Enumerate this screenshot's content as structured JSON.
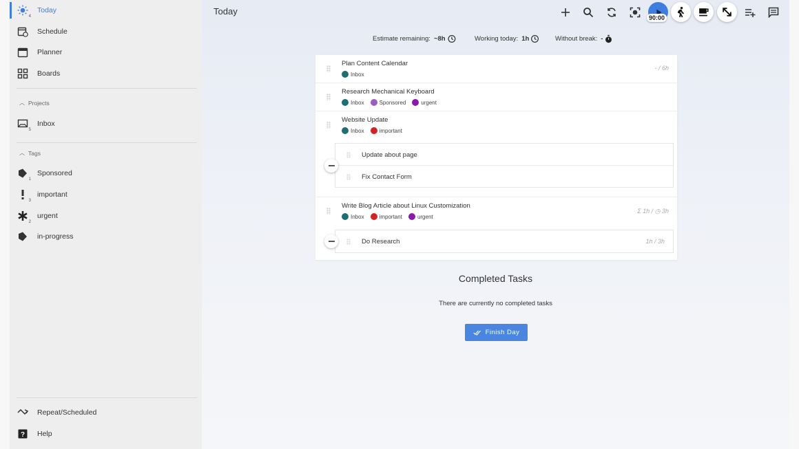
{
  "sidebar": {
    "nav": [
      {
        "label": "Today",
        "badge": "4",
        "active": true
      },
      {
        "label": "Schedule"
      },
      {
        "label": "Planner"
      },
      {
        "label": "Boards"
      }
    ],
    "projects_header": "Projects",
    "projects": [
      {
        "label": "Inbox",
        "badge": "5"
      }
    ],
    "tags_header": "Tags",
    "tags": [
      {
        "label": "Sponsored",
        "badge": "1"
      },
      {
        "label": "important",
        "badge": "3"
      },
      {
        "label": "urgent",
        "badge": "2"
      },
      {
        "label": "in-progress"
      }
    ],
    "bottom": [
      {
        "label": "Repeat/Scheduled"
      },
      {
        "label": "Help"
      }
    ]
  },
  "header": {
    "title": "Today",
    "timer": "90:00"
  },
  "stats": {
    "estimate_label": "Estimate remaining:",
    "estimate_value": "~8h",
    "working_label": "Working today:",
    "working_value": "1h",
    "break_label": "Without break:",
    "break_value": "-"
  },
  "tasks": [
    {
      "title": "Plan Content Calendar",
      "tags": [
        "Inbox"
      ],
      "time": "- / 6h"
    },
    {
      "title": "Research Mechanical Keyboard",
      "tags": [
        "Inbox",
        "Sponsored",
        "urgent"
      ],
      "time": ""
    },
    {
      "title": "Website Update",
      "tags": [
        "Inbox",
        "important"
      ],
      "time": "",
      "subtasks": [
        {
          "title": "Update about page"
        },
        {
          "title": "Fix Contact Form"
        }
      ]
    },
    {
      "title": "Write Blog Article about Linux Customization",
      "tags": [
        "Inbox",
        "important",
        "urgent"
      ],
      "time": "Σ 1h / ◷ 3h",
      "subtasks": [
        {
          "title": "Do Research",
          "time": "1h / 3h"
        }
      ]
    }
  ],
  "tag_colors": {
    "Inbox": "#1f6f72",
    "Sponsored": "#9c5cc0",
    "urgent": "#8a1aa8",
    "important": "#d32222"
  },
  "completed": {
    "title": "Completed Tasks",
    "empty_text": "There are currently no completed tasks",
    "finish_button": "Finish Day"
  },
  "colors": {
    "accent": "#3f7de0",
    "button": "#4a86e0"
  }
}
